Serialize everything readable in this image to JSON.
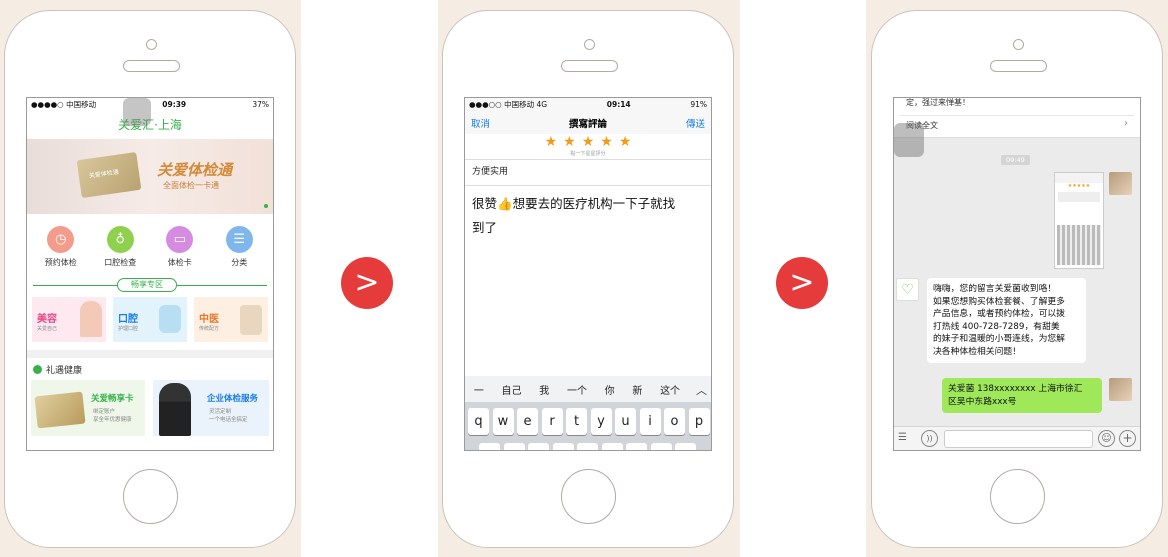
{
  "colors": {
    "green": "#37b24a",
    "blue": "#1a7ee8",
    "orange": "#f29a1a",
    "arrow": "#e63b3b",
    "chat_bg": "#ebebeb",
    "bubble_green": "#9ee85a"
  },
  "arrows": {
    "symbol": ">"
  },
  "phone1": {
    "status": {
      "carrier": "●●●●○ 中国移动",
      "time": "09:39",
      "battery": "37%"
    },
    "title": "关爱汇·上海",
    "banner": {
      "title": "关爱体检通",
      "subtitle": "全面体检一卡通",
      "card_text": "关爱体检通"
    },
    "icons": [
      {
        "label": "预约体检",
        "icon": "clock-icon"
      },
      {
        "label": "口腔检查",
        "icon": "tooth-icon"
      },
      {
        "label": "体检卡",
        "icon": "card-icon"
      },
      {
        "label": "分类",
        "icon": "category-icon"
      }
    ],
    "zone_title": "畅享专区",
    "zones": [
      {
        "title": "美容",
        "subtitle": "关爱自己",
        "color": "#e8478b"
      },
      {
        "title": "口腔",
        "subtitle": "护理口腔",
        "color": "#1a7ee8"
      },
      {
        "title": "中医",
        "subtitle": "传统配方",
        "color": "#e8772a"
      }
    ],
    "gift_title": "礼遇健康",
    "promos": [
      {
        "title": "关爱畅享卡",
        "line1": "绑定账户",
        "line2": "享全年优惠健康"
      },
      {
        "title": "企业体检服务",
        "line1": "灵活定制",
        "line2": "一个电话全搞定"
      }
    ]
  },
  "phone2": {
    "status": {
      "carrier": "●●●○○ 中国移动 4G",
      "time": "09:14",
      "battery": "91%"
    },
    "nav": {
      "cancel": "取消",
      "title": "撰寫評論",
      "send": "傳送"
    },
    "rating": {
      "stars": 5,
      "hint": "點一下星星評分"
    },
    "review_title": "方便实用",
    "review_body_1": "很赞👍想要去的医疗机构一下子就找",
    "review_body_2": "到了",
    "suggestions": [
      "一",
      "自己",
      "我",
      "一个",
      "你",
      "新",
      "这个"
    ],
    "keys_row1": [
      "q",
      "w",
      "e",
      "r",
      "t",
      "y",
      "u",
      "i",
      "o",
      "p"
    ]
  },
  "phone3": {
    "top_text": "定，强过来惮基！",
    "read_more": "阅读全文",
    "time": "09:49",
    "reply_lines": [
      "嗨嗨，您的留言关爱菌收到咯！",
      "如果您想购买体检套餐、了解更多",
      "产品信息，或者预约体检，可以拨",
      "打热线 400-728-7289，有甜美",
      "的妹子和温暖的小哥连线，为您解",
      "决各种体检相关问题！"
    ],
    "phone_number": "400-728-7289",
    "user_msg_1": "关爱菌 138xxxxxxxx 上海市徐汇",
    "user_msg_2": "区吴中东路xxx号"
  }
}
